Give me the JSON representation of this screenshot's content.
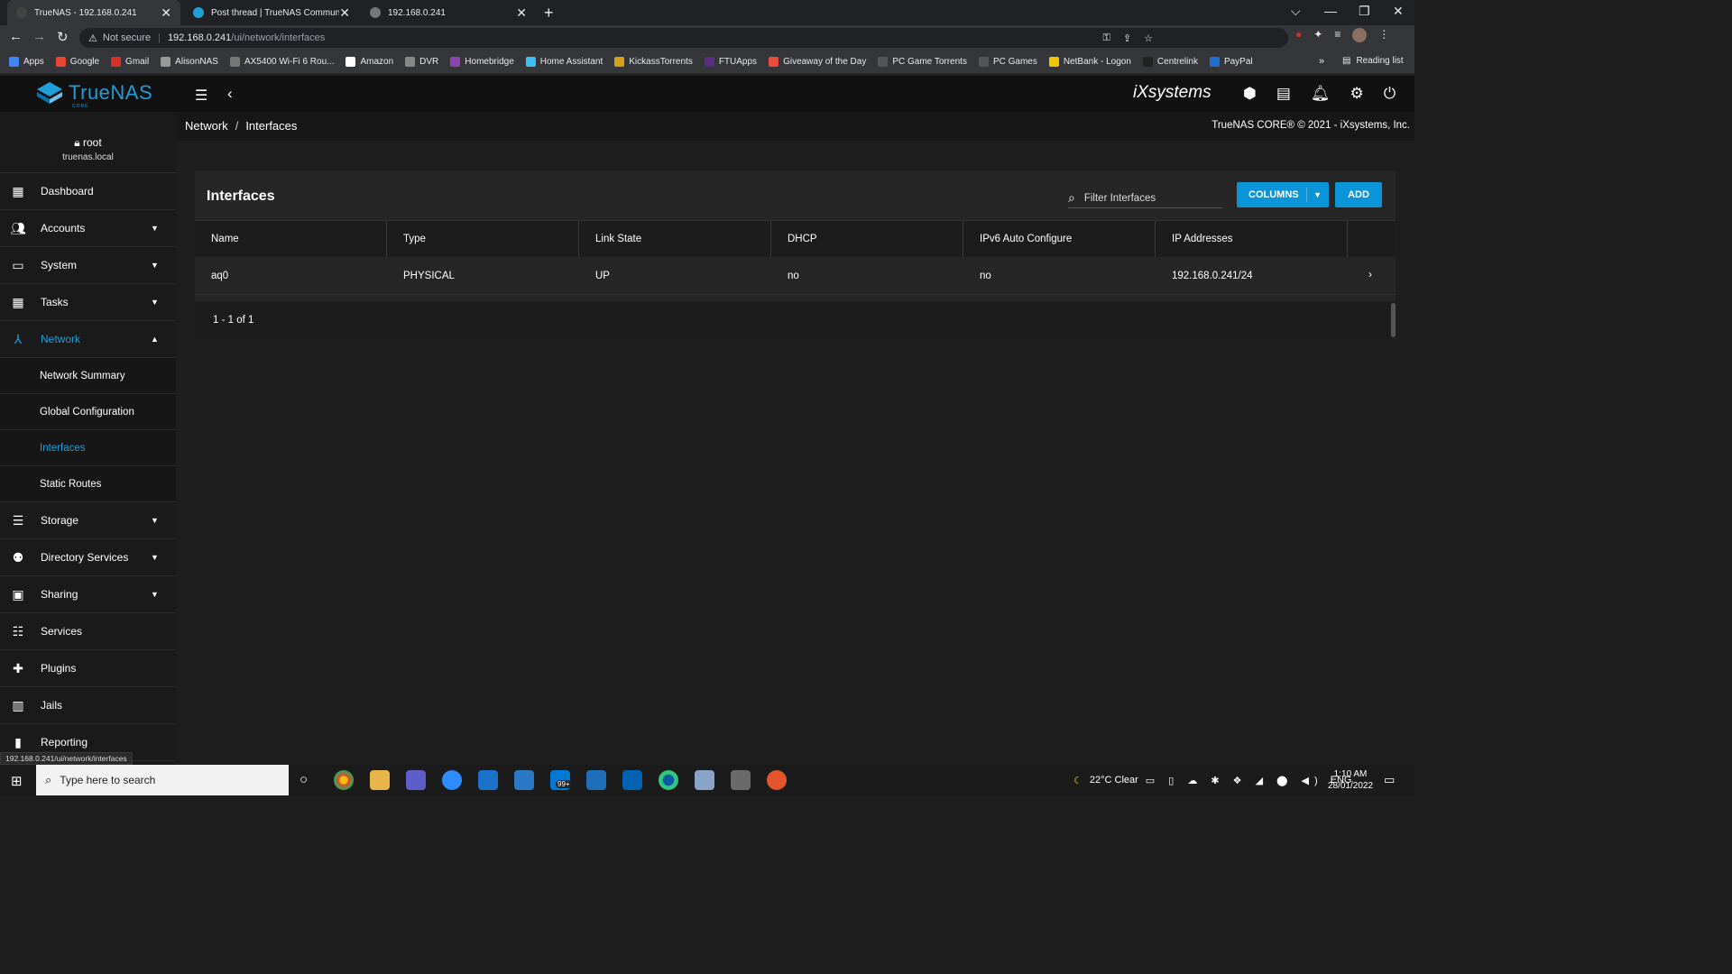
{
  "browser": {
    "tabs": [
      {
        "title": "TrueNAS - 192.168.0.241",
        "active": true
      },
      {
        "title": "Post thread | TrueNAS Communit",
        "active": false
      },
      {
        "title": "192.168.0.241",
        "active": false
      }
    ],
    "new_tab": "+",
    "window_controls": {
      "dropdown": "⌵",
      "minimize": "—",
      "restore": "❐",
      "close": "✕"
    },
    "address": {
      "security_label": "Not secure",
      "host": "192.168.0.241",
      "path": "/ui/network/interfaces"
    },
    "bookmarks": [
      {
        "label": "Apps",
        "color": "#4285f4"
      },
      {
        "label": "Google",
        "color": "#ea4335"
      },
      {
        "label": "Gmail",
        "color": "#d93025"
      },
      {
        "label": "AlisonNAS",
        "color": "#999999"
      },
      {
        "label": "AX5400 Wi-Fi 6 Rou...",
        "color": "#777777"
      },
      {
        "label": "Amazon",
        "color": "#ffffff"
      },
      {
        "label": "DVR",
        "color": "#888888"
      },
      {
        "label": "Homebridge",
        "color": "#8e44ad"
      },
      {
        "label": "Home Assistant",
        "color": "#41bdf5"
      },
      {
        "label": "KickassTorrents",
        "color": "#d4a017"
      },
      {
        "label": "FTUApps",
        "color": "#5b2c83"
      },
      {
        "label": "Giveaway of the Day",
        "color": "#e74c3c"
      },
      {
        "label": "PC Game Torrents",
        "color": "#555555"
      },
      {
        "label": "PC Games",
        "color": "#555555"
      },
      {
        "label": "NetBank - Logon",
        "color": "#f5c400"
      },
      {
        "label": "Centrelink",
        "color": "#222222"
      },
      {
        "label": "PayPal",
        "color": "#1f6fd1"
      }
    ],
    "bookmarks_more": "»",
    "reading_list": "Reading list",
    "status_link": "192.168.0.241/ui/network/interfaces"
  },
  "app": {
    "logo_text": "TrueNAS",
    "logo_sub": "CORE",
    "vendor": "iXsystems",
    "accent": "#1f9ed8"
  },
  "user": {
    "name": "root",
    "host": "truenas.local"
  },
  "sidebar": {
    "items": [
      {
        "label": "Dashboard",
        "icon": "dashboard-icon",
        "caret": ""
      },
      {
        "label": "Accounts",
        "icon": "accounts-icon",
        "caret": "▼"
      },
      {
        "label": "System",
        "icon": "system-icon",
        "caret": "▼"
      },
      {
        "label": "Tasks",
        "icon": "tasks-icon",
        "caret": "▼"
      },
      {
        "label": "Network",
        "icon": "network-icon",
        "caret": "▲"
      },
      {
        "label": "Storage",
        "icon": "storage-icon",
        "caret": "▼"
      },
      {
        "label": "Directory Services",
        "icon": "directory-icon",
        "caret": "▼"
      },
      {
        "label": "Sharing",
        "icon": "sharing-icon",
        "caret": "▼"
      },
      {
        "label": "Services",
        "icon": "services-icon",
        "caret": ""
      },
      {
        "label": "Plugins",
        "icon": "plugins-icon",
        "caret": ""
      },
      {
        "label": "Jails",
        "icon": "jails-icon",
        "caret": ""
      },
      {
        "label": "Reporting",
        "icon": "reporting-icon",
        "caret": ""
      }
    ],
    "network_sub": [
      {
        "label": "Network Summary"
      },
      {
        "label": "Global Configuration"
      },
      {
        "label": "Interfaces"
      },
      {
        "label": "Static Routes"
      }
    ]
  },
  "breadcrumb": {
    "parent": "Network",
    "separator": "/",
    "current": "Interfaces"
  },
  "copyright": "TrueNAS CORE® © 2021 - iXsystems, Inc.",
  "interfaces": {
    "title": "Interfaces",
    "filter_placeholder": "Filter Interfaces",
    "columns_label": "COLUMNS",
    "add_label": "ADD",
    "columns": [
      "Name",
      "Type",
      "Link State",
      "DHCP",
      "IPv6 Auto Configure",
      "IP Addresses"
    ],
    "rows": [
      [
        "aq0",
        "PHYSICAL",
        "UP",
        "no",
        "no",
        "192.168.0.241/24"
      ]
    ],
    "pager": "1 - 1 of 1"
  },
  "taskbar": {
    "search_placeholder": "Type here to search",
    "weather": "22°C  Clear",
    "lang": "ENG",
    "time": "1:10 AM",
    "date": "28/01/2022",
    "badge": "99+"
  }
}
